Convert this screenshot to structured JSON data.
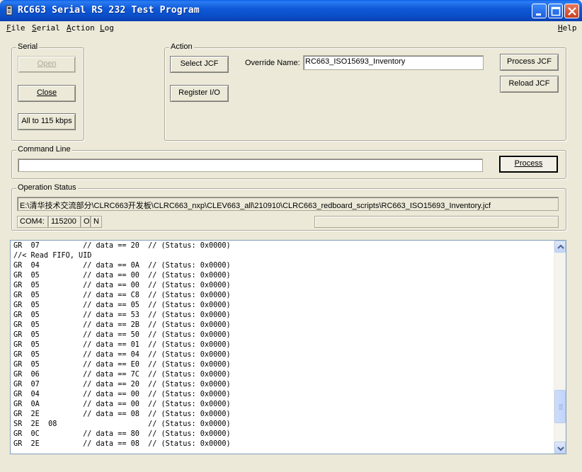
{
  "window": {
    "title": "RC663 Serial RS 232 Test Program"
  },
  "menu": [
    {
      "label": "File",
      "key": "F",
      "rest": "ile"
    },
    {
      "label": "Serial",
      "key": "S",
      "rest": "erial"
    },
    {
      "label": "Action",
      "key": "A",
      "rest": "ction"
    },
    {
      "label": "Log",
      "key": "L",
      "rest": "og"
    },
    {
      "label": "Help",
      "key": "H",
      "rest": "elp"
    }
  ],
  "serial": {
    "group_label": "Serial",
    "open_label": "Open",
    "close_label": "Close",
    "baud_label": "All to 115 kbps"
  },
  "action": {
    "group_label": "Action",
    "select_jcf_label": "Select JCF",
    "register_io_label": "Register I/O",
    "override_name_label": "Override Name:",
    "override_name_value": "RC663_ISO15693_Inventory",
    "process_jcf_label": "Process JCF",
    "reload_jcf_label": "Reload JCF"
  },
  "command_line": {
    "group_label": "Command Line",
    "value": "",
    "process_label": "Process"
  },
  "operation_status": {
    "group_label": "Operation Status",
    "path": "E:\\清华技术交流部分\\CLRC663开发板\\CLRC663_nxp\\CLEV663_all\\210910\\CLRC663_redboard_scripts\\RC663_ISO15693_Inventory.jcf",
    "port": "COM4:",
    "baud": "115200",
    "parity": "O",
    "flow": "N"
  },
  "log": {
    "lines": [
      "GR  07          // data == 20  // (Status: 0x0000)",
      "//< Read FIFO, UID",
      "GR  04          // data == 0A  // (Status: 0x0000)",
      "GR  05          // data == 00  // (Status: 0x0000)",
      "GR  05          // data == 00  // (Status: 0x0000)",
      "GR  05          // data == C8  // (Status: 0x0000)",
      "GR  05          // data == 05  // (Status: 0x0000)",
      "GR  05          // data == 53  // (Status: 0x0000)",
      "GR  05          // data == 2B  // (Status: 0x0000)",
      "GR  05          // data == 50  // (Status: 0x0000)",
      "GR  05          // data == 01  // (Status: 0x0000)",
      "GR  05          // data == 04  // (Status: 0x0000)",
      "GR  05          // data == E0  // (Status: 0x0000)",
      "GR  06          // data == 7C  // (Status: 0x0000)",
      "GR  07          // data == 20  // (Status: 0x0000)",
      "GR  04          // data == 00  // (Status: 0x0000)",
      "GR  0A          // data == 00  // (Status: 0x0000)",
      "GR  2E          // data == 08  // (Status: 0x0000)",
      "SR  2E  08                     // (Status: 0x0000)",
      "GR  0C          // data == 80  // (Status: 0x0000)",
      "GR  2E          // data == 08  // (Status: 0x0000)"
    ]
  },
  "icons": {
    "app": "app-icon",
    "minimize": "minimize-icon",
    "maximize": "maximize-icon",
    "close": "close-icon",
    "scroll_up": "scroll-up-icon",
    "scroll_down": "scroll-down-icon"
  },
  "colors": {
    "titlebar": "#0a4cc6",
    "close_button": "#c6401f",
    "window_face": "#ece9d8"
  }
}
